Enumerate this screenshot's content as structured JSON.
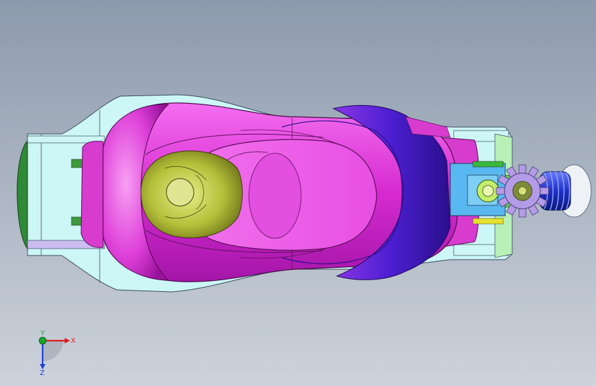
{
  "viewport": {
    "background_top": "#8d9aad",
    "background_bottom": "#cdd3db"
  },
  "colors": {
    "body_magenta": "#e03ad6",
    "body_purple": "#4a1fc8",
    "frame_cyan": "#c9f4f4",
    "inner_olive": "#c7d24a",
    "gear_lavender": "#b49be6",
    "spring_blue": "#2c3fd8",
    "bracket_blue": "#5ab8f0",
    "tab_green": "#2f9a2f",
    "tab_yellow": "#e6e232"
  },
  "triad": {
    "x_label": "X",
    "y_label": "Y",
    "z_label": "Z",
    "x_color": "#e01b1b",
    "y_color": "#17a82a",
    "z_color": "#1f3fd6"
  }
}
